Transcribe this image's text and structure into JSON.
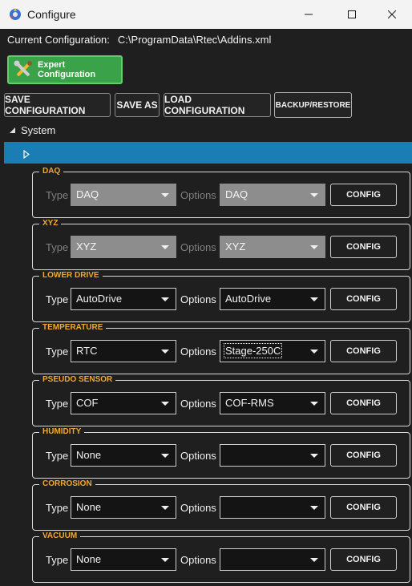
{
  "window": {
    "title": "Configure"
  },
  "current_config": {
    "label": "Current Configuration:",
    "path": "C:\\ProgramData\\Rtec\\Addins.xml"
  },
  "toolbar": {
    "expert_label": "Expert Configuration",
    "save_label": "SAVE CONFIGURATION",
    "save_as_label": "SAVE AS",
    "load_label": "LOAD CONFIGURATION",
    "backup_label": "BACKUP/RESTORE"
  },
  "tree": {
    "root_label": "System"
  },
  "groups": [
    {
      "title": "DAQ",
      "type_label": "Type",
      "type_value": "DAQ",
      "options_label": "Options",
      "options_value": "DAQ",
      "config_label": "CONFIG",
      "disabled": true
    },
    {
      "title": "XYZ",
      "type_label": "Type",
      "type_value": "XYZ",
      "options_label": "Options",
      "options_value": "XYZ",
      "config_label": "CONFIG",
      "disabled": true
    },
    {
      "title": "LOWER DRIVE",
      "type_label": "Type",
      "type_value": "AutoDrive",
      "options_label": "Options",
      "options_value": "AutoDrive",
      "config_label": "CONFIG",
      "disabled": false
    },
    {
      "title": "TEMPERATURE",
      "type_label": "Type",
      "type_value": "RTC",
      "options_label": "Options",
      "options_value": "Stage-250C",
      "config_label": "CONFIG",
      "disabled": false
    },
    {
      "title": "PSEUDO SENSOR",
      "type_label": "Type",
      "type_value": "COF",
      "options_label": "Options",
      "options_value": "COF-RMS",
      "config_label": "CONFIG",
      "disabled": false
    },
    {
      "title": "HUMIDITY",
      "type_label": "Type",
      "type_value": "None",
      "options_label": "Options",
      "options_value": "",
      "config_label": "CONFIG",
      "disabled": false
    },
    {
      "title": "CORROSION",
      "type_label": "Type",
      "type_value": "None",
      "options_label": "Options",
      "options_value": "",
      "config_label": "CONFIG",
      "disabled": false
    },
    {
      "title": "VACUUM",
      "type_label": "Type",
      "type_value": "None",
      "options_label": "Options",
      "options_value": "",
      "config_label": "CONFIG",
      "disabled": false
    }
  ],
  "colors": {
    "accent_selection": "#1a7db3",
    "group_title": "#f0a830",
    "expert_button": "#3aa34a"
  },
  "icons": {
    "app": "app-gear-icon",
    "expert": "tools-icon"
  }
}
